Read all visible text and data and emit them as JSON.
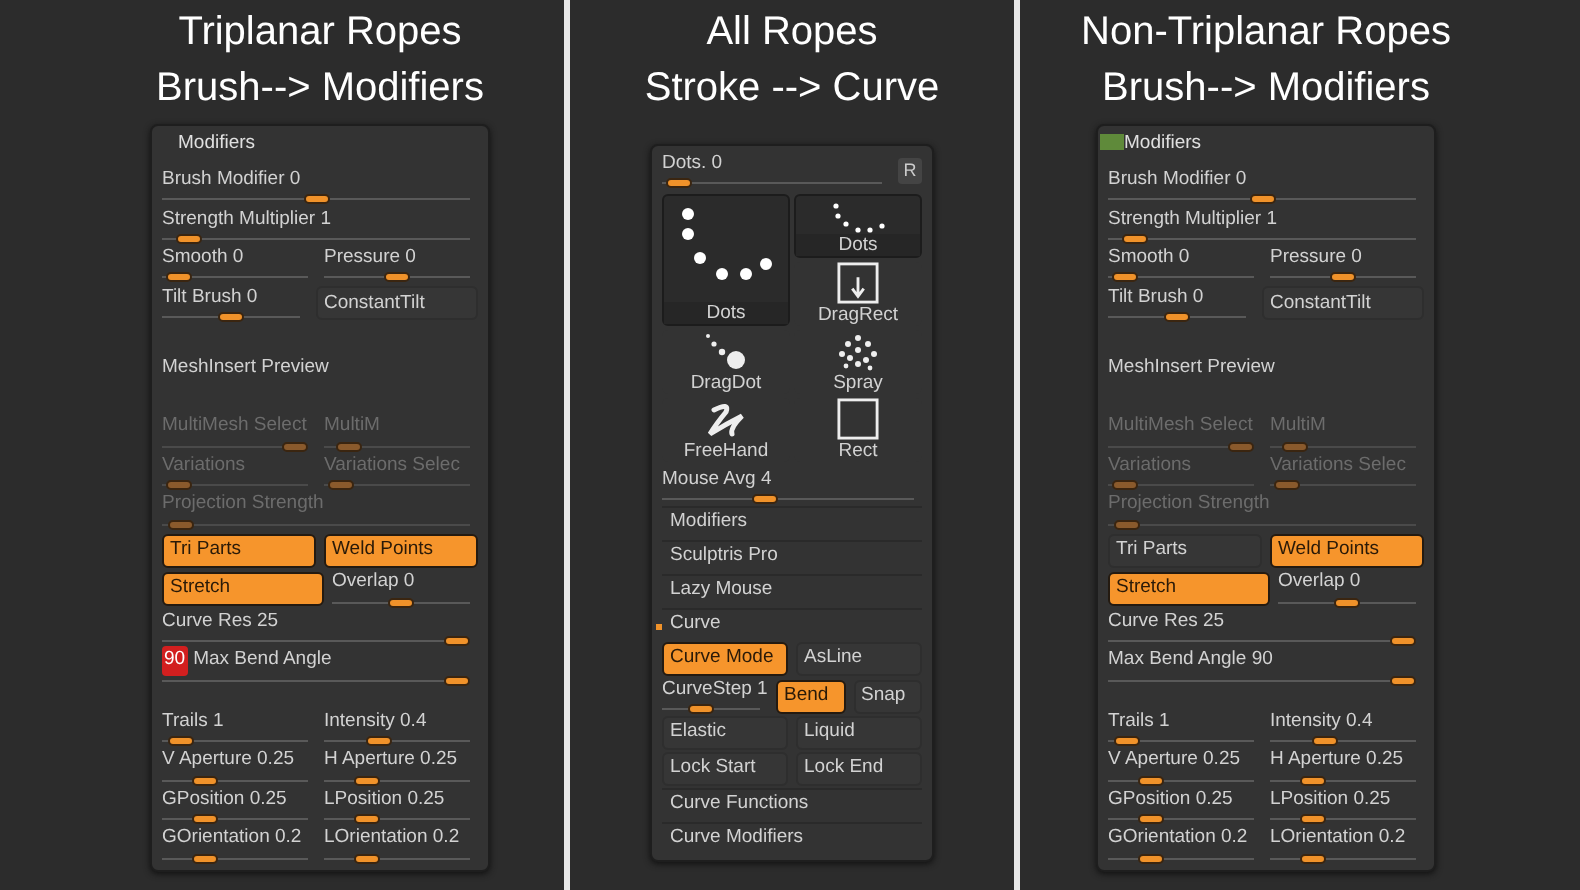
{
  "columns": [
    {
      "heading": [
        "Triplanar Ropes",
        "Brush--> Modifiers"
      ],
      "panel": {
        "title": "Modifiers",
        "indicator": false,
        "groups": [
          [
            {
              "items": [
                {
                  "kind": "slider",
                  "label": "Brush Modifier 0",
                  "level": 0.5
                }
              ]
            },
            {
              "items": [
                {
                  "kind": "slider",
                  "label": "Strength Multiplier 1",
                  "level": 0.05
                }
              ]
            },
            {
              "items": [
                {
                  "kind": "slider",
                  "label": "Smooth 0",
                  "level": 0.03
                },
                {
                  "kind": "slider",
                  "label": "Pressure 0",
                  "level": 0.5
                }
              ]
            },
            {
              "items": [
                {
                  "kind": "slider",
                  "label": "Tilt Brush 0",
                  "level": 0.5
                },
                {
                  "kind": "toggle",
                  "label": "ConstantTilt",
                  "on": false
                }
              ]
            }
          ],
          [
            {
              "items": [
                {
                  "kind": "label",
                  "label": "MeshInsert Preview"
                }
              ]
            }
          ],
          [
            {
              "items": [
                {
                  "kind": "slider",
                  "label": "MultiMesh Select",
                  "level": 1,
                  "disabled": true
                },
                {
                  "kind": "slider",
                  "label": "MultiM",
                  "level": 0.1,
                  "disabled": true
                }
              ]
            },
            {
              "items": [
                {
                  "kind": "slider",
                  "label": "Variations",
                  "level": 0.03,
                  "disabled": true
                },
                {
                  "kind": "slider",
                  "label": "Variations Selec",
                  "level": 0.03,
                  "disabled": true
                }
              ]
            },
            {
              "items": [
                {
                  "kind": "slider",
                  "label": "Projection Strength",
                  "level": 0.02,
                  "disabled": true
                }
              ]
            },
            {
              "items": [
                {
                  "kind": "toggle",
                  "label": "Tri Parts",
                  "on": true
                },
                {
                  "kind": "toggle",
                  "label": "Weld Points",
                  "on": true
                }
              ]
            },
            {
              "items": [
                {
                  "kind": "toggle",
                  "label": "Stretch",
                  "on": true
                },
                {
                  "kind": "slider",
                  "label": "Overlap 0",
                  "level": 0.5
                }
              ]
            },
            {
              "items": [
                {
                  "kind": "slider",
                  "label": "Curve Res 25",
                  "level": 1
                }
              ]
            },
            {
              "items": [
                {
                  "kind": "slider",
                  "badge": "90",
                  "label": "Max Bend Angle",
                  "level": 1
                }
              ]
            }
          ],
          [
            {
              "items": [
                {
                  "kind": "slider",
                  "label": "Trails 1",
                  "level": 0.05
                },
                {
                  "kind": "slider",
                  "label": "Intensity 0.4",
                  "level": 0.35
                }
              ]
            },
            {
              "items": [
                {
                  "kind": "slider",
                  "label": "V Aperture 0.25",
                  "level": 0.25
                },
                {
                  "kind": "slider",
                  "label": "H Aperture 0.25",
                  "level": 0.25
                }
              ]
            },
            {
              "items": [
                {
                  "kind": "slider",
                  "label": "GPosition 0.25",
                  "level": 0.25
                },
                {
                  "kind": "slider",
                  "label": "LPosition 0.25",
                  "level": 0.25
                }
              ]
            },
            {
              "items": [
                {
                  "kind": "slider",
                  "label": "GOrientation 0.2",
                  "level": 0.25
                },
                {
                  "kind": "slider",
                  "label": "LOrientation 0.2",
                  "level": 0.25
                }
              ]
            }
          ]
        ]
      }
    },
    {
      "heading": [
        "All Ropes",
        "Stroke --> Curve"
      ],
      "panel": {
        "groups": [
          [
            {
              "items": [
                {
                  "kind": "slider",
                  "label": "Dots. 0",
                  "level": 0.02,
                  "button": "R"
                }
              ]
            },
            {
              "items": [
                {
                  "kind": "strokes",
                  "strokes": [
                    {
                      "kind": "dots",
                      "label": "Dots",
                      "selected": true
                    },
                    {
                      "kind": "drag-dot",
                      "label": "DragDot",
                      "selected": false
                    },
                    {
                      "kind": "freehand",
                      "label": "FreeHand",
                      "selected": false
                    },
                    {
                      "kind": "dots",
                      "label": "Dots",
                      "selected": false
                    },
                    {
                      "kind": "drag-rect",
                      "label": "DragRect",
                      "selected": false
                    },
                    {
                      "kind": "spray",
                      "label": "Spray",
                      "selected": false
                    },
                    {
                      "kind": "rect",
                      "label": "Rect",
                      "selected": false
                    }
                  ]
                }
              ]
            },
            {
              "items": [
                {
                  "kind": "slider",
                  "label": "Mouse Avg 4",
                  "level": 0.4
                }
              ]
            },
            {
              "items": [
                {
                  "kind": "section",
                  "label": "Modifiers",
                  "expanded": false
                }
              ]
            },
            {
              "items": [
                {
                  "kind": "section",
                  "label": "Sculptris Pro",
                  "expanded": false
                }
              ]
            },
            {
              "items": [
                {
                  "kind": "section",
                  "label": "Lazy Mouse",
                  "expanded": false
                }
              ]
            },
            {
              "items": [
                {
                  "kind": "section",
                  "label": "Curve",
                  "expanded": true
                }
              ]
            },
            {
              "items": [
                {
                  "kind": "toggle",
                  "label": "Curve Mode",
                  "on": true
                },
                {
                  "kind": "toggle",
                  "label": "AsLine",
                  "on": false
                }
              ]
            },
            {
              "items": [
                {
                  "kind": "slider",
                  "label": "CurveStep 1",
                  "level": 0.35
                },
                {
                  "kind": "toggle",
                  "label": "Bend",
                  "on": true
                },
                {
                  "kind": "toggle",
                  "label": "Snap",
                  "on": false
                }
              ]
            },
            {
              "items": [
                {
                  "kind": "toggle",
                  "label": "Elastic",
                  "on": false
                },
                {
                  "kind": "toggle",
                  "label": "Liquid",
                  "on": false
                }
              ]
            },
            {
              "items": [
                {
                  "kind": "toggle",
                  "label": "Lock Start",
                  "on": false
                },
                {
                  "kind": "toggle",
                  "label": "Lock End",
                  "on": false
                }
              ]
            },
            {
              "items": [
                {
                  "kind": "section",
                  "label": "Curve Functions",
                  "expanded": false
                }
              ]
            },
            {
              "items": [
                {
                  "kind": "section",
                  "label": "Curve Modifiers",
                  "expanded": false
                }
              ]
            }
          ]
        ]
      }
    },
    {
      "heading": [
        "Non-Triplanar Ropes",
        "Brush--> Modifiers"
      ],
      "panel": {
        "title": "Modifiers",
        "indicator": true,
        "groups": [
          [
            {
              "items": [
                {
                  "kind": "slider",
                  "label": "Brush Modifier 0",
                  "level": 0.5
                }
              ]
            },
            {
              "items": [
                {
                  "kind": "slider",
                  "label": "Strength Multiplier 1",
                  "level": 0.05
                }
              ]
            },
            {
              "items": [
                {
                  "kind": "slider",
                  "label": "Smooth 0",
                  "level": 0.03
                },
                {
                  "kind": "slider",
                  "label": "Pressure 0",
                  "level": 0.5
                }
              ]
            },
            {
              "items": [
                {
                  "kind": "slider",
                  "label": "Tilt Brush 0",
                  "level": 0.5
                },
                {
                  "kind": "toggle",
                  "label": "ConstantTilt",
                  "on": false
                }
              ]
            }
          ],
          [
            {
              "items": [
                {
                  "kind": "label",
                  "label": "MeshInsert Preview"
                }
              ]
            }
          ],
          [
            {
              "items": [
                {
                  "kind": "slider",
                  "label": "MultiMesh Select",
                  "level": 1,
                  "disabled": true
                },
                {
                  "kind": "slider",
                  "label": "MultiM",
                  "level": 0.1,
                  "disabled": true
                }
              ]
            },
            {
              "items": [
                {
                  "kind": "slider",
                  "label": "Variations",
                  "level": 0.03,
                  "disabled": true
                },
                {
                  "kind": "slider",
                  "label": "Variations Selec",
                  "level": 0.03,
                  "disabled": true
                }
              ]
            },
            {
              "items": [
                {
                  "kind": "slider",
                  "label": "Projection Strength",
                  "level": 0.02,
                  "disabled": true
                }
              ]
            },
            {
              "items": [
                {
                  "kind": "toggle",
                  "label": "Tri Parts",
                  "on": false
                },
                {
                  "kind": "toggle",
                  "label": "Weld Points",
                  "on": true
                }
              ]
            },
            {
              "items": [
                {
                  "kind": "toggle",
                  "label": "Stretch",
                  "on": true
                },
                {
                  "kind": "slider",
                  "label": "Overlap 0",
                  "level": 0.5
                }
              ]
            },
            {
              "items": [
                {
                  "kind": "slider",
                  "label": "Curve Res 25",
                  "level": 1
                }
              ]
            },
            {
              "items": [
                {
                  "kind": "slider",
                  "label": "Max Bend Angle 90",
                  "level": 1
                }
              ]
            }
          ],
          [
            {
              "items": [
                {
                  "kind": "slider",
                  "label": "Trails 1",
                  "level": 0.05
                },
                {
                  "kind": "slider",
                  "label": "Intensity 0.4",
                  "level": 0.35
                }
              ]
            },
            {
              "items": [
                {
                  "kind": "slider",
                  "label": "V Aperture 0.25",
                  "level": 0.25
                },
                {
                  "kind": "slider",
                  "label": "H Aperture 0.25",
                  "level": 0.25
                }
              ]
            },
            {
              "items": [
                {
                  "kind": "slider",
                  "label": "GPosition 0.25",
                  "level": 0.25
                },
                {
                  "kind": "slider",
                  "label": "LPosition 0.25",
                  "level": 0.25
                }
              ]
            },
            {
              "items": [
                {
                  "kind": "slider",
                  "label": "GOrientation 0.2",
                  "level": 0.25
                },
                {
                  "kind": "slider",
                  "label": "LOrientation 0.2",
                  "level": 0.25
                }
              ]
            }
          ]
        ]
      }
    }
  ]
}
